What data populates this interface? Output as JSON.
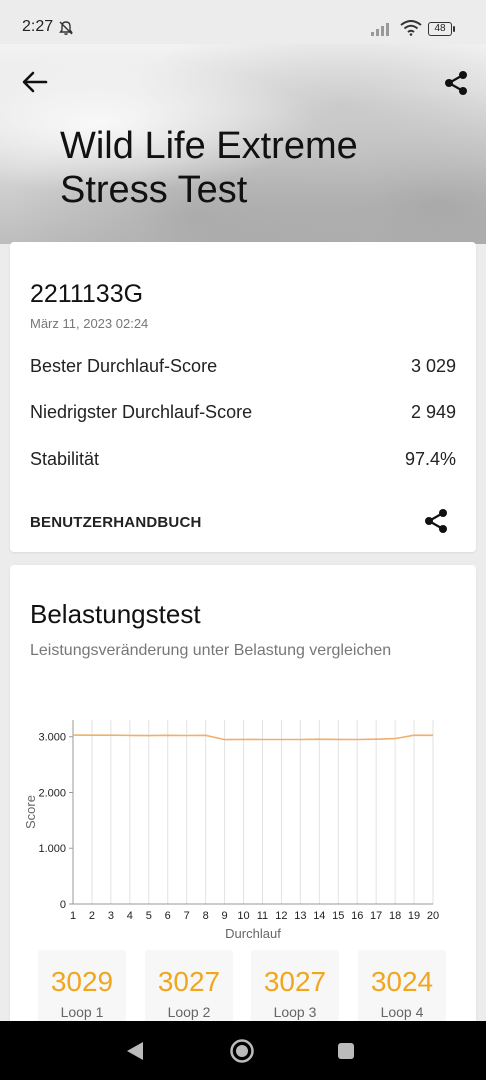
{
  "status": {
    "time": "2:27",
    "battery": "48"
  },
  "header": {
    "title": "Wild Life Extreme Stress Test"
  },
  "summary": {
    "device": "2211133G",
    "date": "März 11, 2023 02:24",
    "rows": [
      {
        "label": "Bester Durchlauf-Score",
        "value": "3 029"
      },
      {
        "label": "Niedrigster Durchlauf-Score",
        "value": "2 949"
      },
      {
        "label": "Stabilität",
        "value": "97.4%"
      }
    ],
    "manual_label": "BENUTZERHANDBUCH"
  },
  "stress": {
    "title": "Belastungstest",
    "subtitle": "Leistungsveränderung unter Belastung vergleichen"
  },
  "chart_data": {
    "type": "line",
    "xlabel": "Durchlauf",
    "ylabel": "Score",
    "x": [
      1,
      2,
      3,
      4,
      5,
      6,
      7,
      8,
      9,
      10,
      11,
      12,
      13,
      14,
      15,
      16,
      17,
      18,
      19,
      20
    ],
    "values": [
      3029,
      3027,
      3027,
      3024,
      3020,
      3026,
      3022,
      3025,
      2949,
      2952,
      2950,
      2950,
      2951,
      2955,
      2952,
      2950,
      2955,
      2966,
      3028,
      3026
    ],
    "ylim": [
      0,
      3300
    ],
    "yticks": [
      "0",
      "1.000",
      "2.000",
      "3.000"
    ],
    "line_color": "#f0b06a",
    "grid": true
  },
  "loops": [
    {
      "score": "3029",
      "label": "Loop 1"
    },
    {
      "score": "3027",
      "label": "Loop 2"
    },
    {
      "score": "3027",
      "label": "Loop 3"
    },
    {
      "score": "3024",
      "label": "Loop 4"
    }
  ],
  "colors": {
    "accent": "#f0a71e",
    "line": "#f0b06a"
  }
}
